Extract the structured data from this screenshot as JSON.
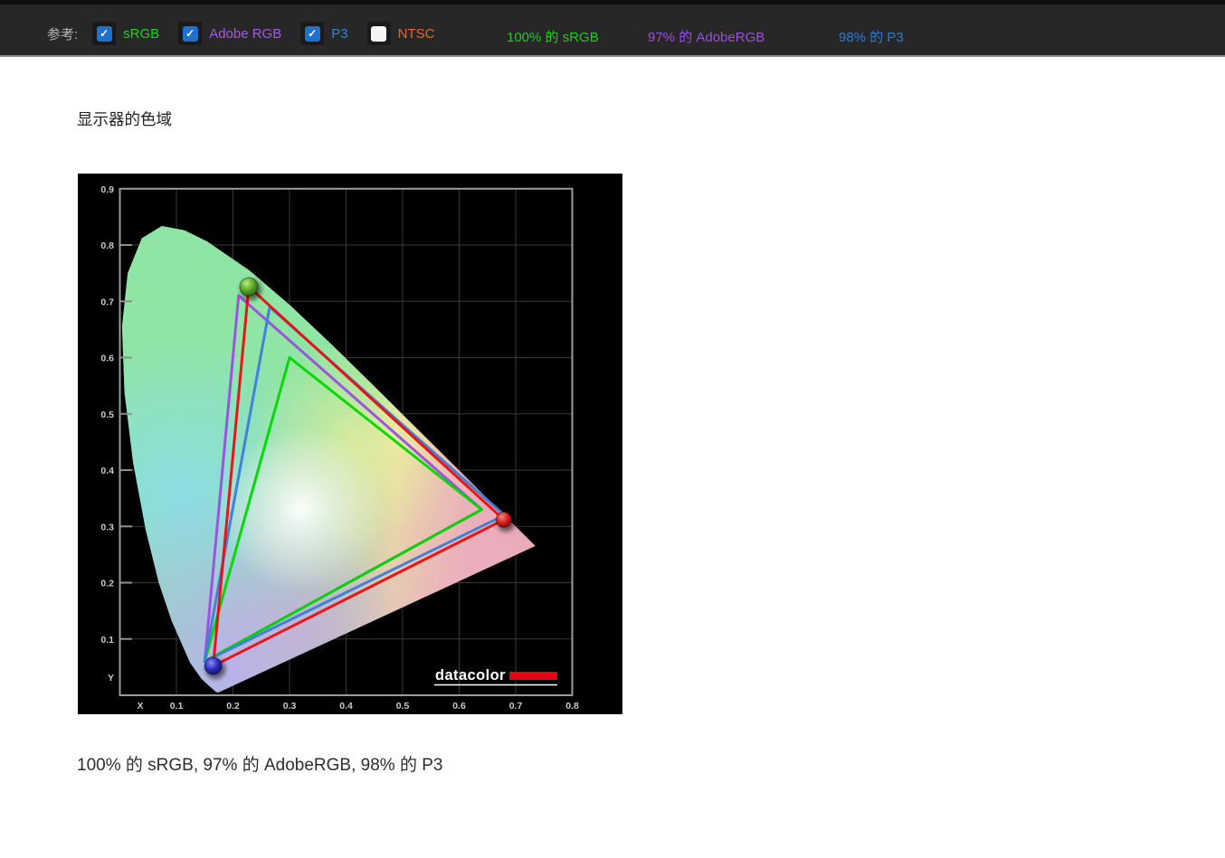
{
  "toolbar": {
    "reference_label": "参考:",
    "check_glyph": "✓",
    "checkbox_checked_color": "#1d72cf",
    "checkboxes": [
      {
        "label": "sRGB",
        "checked": true,
        "color": "#22cf22"
      },
      {
        "label": "Adobe RGB",
        "checked": true,
        "color": "#a55ae0"
      },
      {
        "label": "P3",
        "checked": true,
        "color": "#3c82d8"
      },
      {
        "label": "NTSC",
        "checked": false,
        "color": "#e06a2e"
      }
    ],
    "readouts": [
      {
        "text": "100% 的 sRGB",
        "color": "#1ecb1e"
      },
      {
        "text": "97% 的 AdobeRGB",
        "color": "#9a50d8"
      },
      {
        "text": "98% 的 P3",
        "color": "#3579cb"
      }
    ]
  },
  "main": {
    "title": "显示器的色域",
    "caption": "100% 的 sRGB, 97% 的 AdobeRGB, 98% 的 P3"
  },
  "chart_data": {
    "type": "scatter",
    "subtype": "CIE-1931-chromaticity-diagram",
    "title": "显示器的色域",
    "xlabel": "X",
    "ylabel": "Y",
    "xlim": [
      0,
      0.8
    ],
    "ylim": [
      0,
      0.9
    ],
    "x_ticks": [
      0.1,
      0.2,
      0.3,
      0.4,
      0.5,
      0.6,
      0.7,
      0.8
    ],
    "y_ticks": [
      0.1,
      0.2,
      0.3,
      0.4,
      0.5,
      0.6,
      0.7,
      0.8,
      0.9
    ],
    "grid": true,
    "logo_text": "datacolor",
    "coverage": {
      "sRGB": 100,
      "AdobeRGB": 97,
      "P3": 98
    },
    "series": [
      {
        "name": "Adobe RGB reference gamut",
        "color": "#9b4fe0",
        "points": [
          [
            0.64,
            0.33
          ],
          [
            0.21,
            0.71
          ],
          [
            0.15,
            0.06
          ]
        ]
      },
      {
        "name": "sRGB reference gamut",
        "color": "#00d800",
        "points": [
          [
            0.64,
            0.33
          ],
          [
            0.3,
            0.6
          ],
          [
            0.15,
            0.06
          ]
        ]
      },
      {
        "name": "P3 reference gamut",
        "color": "#3d7fd8",
        "points": [
          [
            0.68,
            0.32
          ],
          [
            0.265,
            0.69
          ],
          [
            0.15,
            0.06
          ]
        ]
      },
      {
        "name": "measured display gamut",
        "color": "#ea1010",
        "points": [
          [
            0.679,
            0.312
          ],
          [
            0.228,
            0.726
          ],
          [
            0.165,
            0.052
          ]
        ]
      }
    ],
    "primaries": [
      {
        "name": "green-primary",
        "x": 0.228,
        "y": 0.726,
        "sphere": "green",
        "r": 10
      },
      {
        "name": "red-primary",
        "x": 0.679,
        "y": 0.312,
        "sphere": "red",
        "r": 8.5
      },
      {
        "name": "blue-primary",
        "x": 0.165,
        "y": 0.052,
        "sphere": "blue",
        "r": 9.5
      }
    ],
    "spectral_locus": [
      [
        0.1741,
        0.005
      ],
      [
        0.1714,
        0.0051
      ],
      [
        0.1689,
        0.0069
      ],
      [
        0.1644,
        0.0109
      ],
      [
        0.1566,
        0.0177
      ],
      [
        0.144,
        0.0297
      ],
      [
        0.1241,
        0.0578
      ],
      [
        0.0913,
        0.1327
      ],
      [
        0.0687,
        0.2007
      ],
      [
        0.0454,
        0.295
      ],
      [
        0.0235,
        0.4127
      ],
      [
        0.0082,
        0.5384
      ],
      [
        0.0039,
        0.6548
      ],
      [
        0.0139,
        0.7502
      ],
      [
        0.0389,
        0.812
      ],
      [
        0.0743,
        0.8338
      ],
      [
        0.1142,
        0.8262
      ],
      [
        0.1547,
        0.8059
      ],
      [
        0.2296,
        0.7543
      ],
      [
        0.3016,
        0.6923
      ],
      [
        0.3731,
        0.6245
      ],
      [
        0.4441,
        0.5547
      ],
      [
        0.5125,
        0.4866
      ],
      [
        0.5752,
        0.4242
      ],
      [
        0.627,
        0.3725
      ],
      [
        0.6658,
        0.334
      ],
      [
        0.6915,
        0.3083
      ],
      [
        0.714,
        0.2859
      ],
      [
        0.7347,
        0.2653
      ]
    ]
  }
}
